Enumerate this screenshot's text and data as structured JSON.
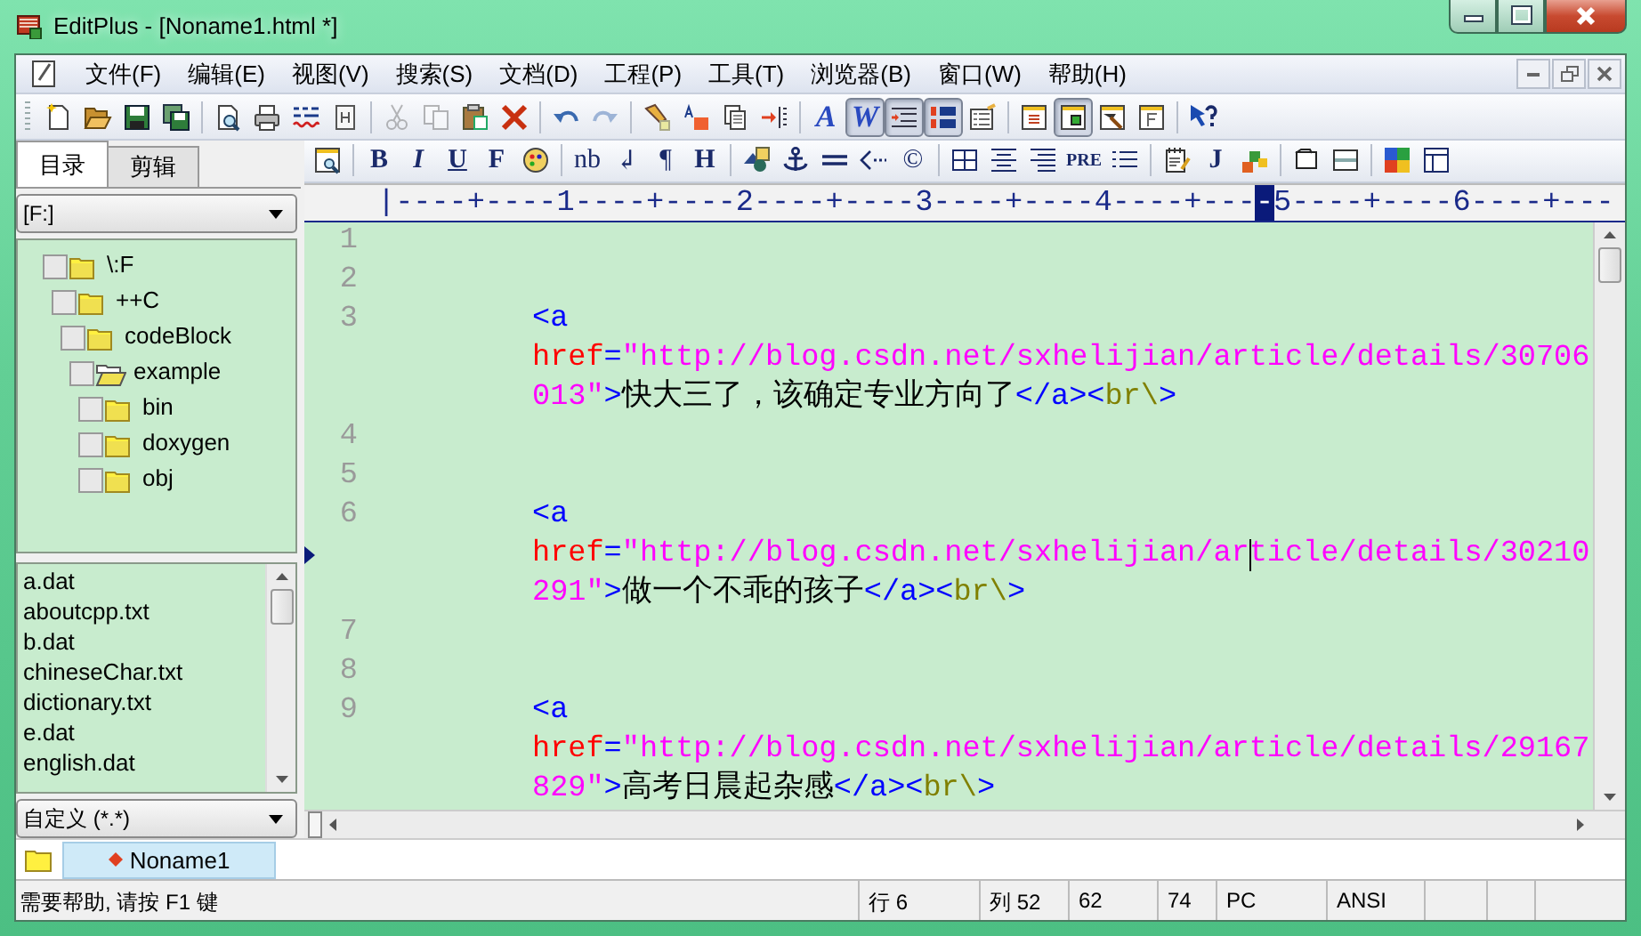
{
  "window": {
    "title": "EditPlus - [Noname1.html *]"
  },
  "menu": [
    "文件(F)",
    "编辑(E)",
    "视图(V)",
    "搜索(S)",
    "文档(D)",
    "工程(P)",
    "工具(T)",
    "浏览器(B)",
    "窗口(W)",
    "帮助(H)"
  ],
  "toolbar_main": [
    {
      "kind": "icon",
      "pressed": false,
      "disabled": false
    },
    {
      "kind": "icon",
      "pressed": false,
      "disabled": false
    },
    {
      "kind": "icon",
      "pressed": false,
      "disabled": false
    },
    {
      "kind": "icon",
      "pressed": false,
      "disabled": false
    },
    {
      "kind": "sep"
    },
    {
      "kind": "icon",
      "pressed": false,
      "disabled": false
    },
    {
      "kind": "icon",
      "pressed": false,
      "disabled": false
    },
    {
      "kind": "icon",
      "pressed": false,
      "disabled": false
    },
    {
      "kind": "icon",
      "pressed": false,
      "disabled": false
    },
    {
      "kind": "sep"
    },
    {
      "kind": "icon",
      "pressed": false,
      "disabled": true
    },
    {
      "kind": "icon",
      "pressed": false,
      "disabled": true
    },
    {
      "kind": "icon",
      "pressed": false,
      "disabled": false
    },
    {
      "kind": "icon",
      "pressed": false,
      "disabled": false
    },
    {
      "kind": "sep"
    },
    {
      "kind": "icon",
      "pressed": false,
      "disabled": false
    },
    {
      "kind": "icon",
      "pressed": false,
      "disabled": true
    },
    {
      "kind": "sep"
    },
    {
      "kind": "icon",
      "pressed": false,
      "disabled": false
    },
    {
      "kind": "icon",
      "pressed": false,
      "disabled": false
    },
    {
      "kind": "icon",
      "pressed": false,
      "disabled": false
    },
    {
      "kind": "icon",
      "pressed": false,
      "disabled": false
    },
    {
      "kind": "sep"
    },
    {
      "kind": "text",
      "label": "A",
      "pressed": false,
      "disabled": false
    },
    {
      "kind": "text",
      "label": "W",
      "pressed": true,
      "disabled": false
    },
    {
      "kind": "icon",
      "pressed": true,
      "disabled": false
    },
    {
      "kind": "icon",
      "pressed": true,
      "disabled": false
    },
    {
      "kind": "icon",
      "pressed": false,
      "disabled": false
    },
    {
      "kind": "sep"
    },
    {
      "kind": "icon",
      "pressed": false,
      "disabled": false
    },
    {
      "kind": "icon",
      "pressed": true,
      "disabled": false
    },
    {
      "kind": "icon",
      "pressed": false,
      "disabled": false
    },
    {
      "kind": "icon",
      "pressed": false,
      "disabled": false
    },
    {
      "kind": "sep"
    },
    {
      "kind": "icon",
      "pressed": false,
      "disabled": false
    }
  ],
  "toolbar_html": [
    {
      "kind": "icon",
      "pressed": false,
      "disabled": false
    },
    {
      "kind": "sep"
    },
    {
      "kind": "text",
      "label": "B",
      "pressed": false,
      "disabled": false
    },
    {
      "kind": "text",
      "label": "I",
      "pressed": false,
      "disabled": false
    },
    {
      "kind": "text",
      "label": "U",
      "pressed": false,
      "disabled": false
    },
    {
      "kind": "text",
      "label": "F",
      "pressed": false,
      "disabled": false
    },
    {
      "kind": "icon",
      "pressed": false,
      "disabled": false
    },
    {
      "kind": "sep"
    },
    {
      "kind": "text",
      "label": "nb",
      "pressed": false,
      "disabled": false
    },
    {
      "kind": "text",
      "label": "↲",
      "pressed": false,
      "disabled": false
    },
    {
      "kind": "text",
      "label": "¶",
      "pressed": false,
      "disabled": false
    },
    {
      "kind": "text",
      "label": "H",
      "pressed": false,
      "disabled": false
    },
    {
      "kind": "sep"
    },
    {
      "kind": "icon",
      "pressed": false,
      "disabled": false
    },
    {
      "kind": "icon",
      "pressed": false,
      "disabled": false
    },
    {
      "kind": "icon",
      "pressed": false,
      "disabled": false
    },
    {
      "kind": "icon",
      "pressed": false,
      "disabled": false
    },
    {
      "kind": "text",
      "label": "©",
      "pressed": false,
      "disabled": false
    },
    {
      "kind": "sep"
    },
    {
      "kind": "icon",
      "pressed": false,
      "disabled": false
    },
    {
      "kind": "icon",
      "pressed": false,
      "disabled": false
    },
    {
      "kind": "icon",
      "pressed": false,
      "disabled": false
    },
    {
      "kind": "text",
      "label": "PRE",
      "pressed": false,
      "disabled": false
    },
    {
      "kind": "icon",
      "pressed": false,
      "disabled": false
    },
    {
      "kind": "sep"
    },
    {
      "kind": "icon",
      "pressed": false,
      "disabled": false
    },
    {
      "kind": "text",
      "label": "J",
      "pressed": false,
      "disabled": false
    },
    {
      "kind": "icon",
      "pressed": false,
      "disabled": false
    },
    {
      "kind": "sep"
    },
    {
      "kind": "icon",
      "pressed": false,
      "disabled": false
    },
    {
      "kind": "icon",
      "pressed": false,
      "disabled": false
    },
    {
      "kind": "sep"
    },
    {
      "kind": "icon",
      "pressed": false,
      "disabled": false
    },
    {
      "kind": "icon",
      "pressed": false,
      "disabled": false
    }
  ],
  "sidebar": {
    "tabs": [
      {
        "label": "目录",
        "selected": true
      },
      {
        "label": "剪辑",
        "selected": false
      }
    ],
    "drive": "[F:]",
    "tree": [
      {
        "label": "\\:F",
        "open": false,
        "children": [
          {
            "label": "++C",
            "open": false,
            "children": [
              {
                "label": "codeBlock",
                "open": false,
                "children": [
                  {
                    "label": "example",
                    "open": true,
                    "children": [
                      {
                        "label": "bin",
                        "open": false
                      },
                      {
                        "label": "doxygen",
                        "open": false
                      },
                      {
                        "label": "obj",
                        "open": false
                      }
                    ]
                  }
                ]
              }
            ]
          }
        ]
      }
    ],
    "files": [
      "a.dat",
      "aboutcpp.txt",
      "b.dat",
      "chineseChar.txt",
      "dictionary.txt",
      "e.dat",
      "english.dat"
    ],
    "filter": "自定义 (*.*)"
  },
  "editor": {
    "ruler": {
      "before": "|----+----1----+----2----+----3----+----4----+---",
      "marker": "-",
      "after": "5----+----6----+---"
    },
    "lines": [
      {
        "number": "1"
      },
      {
        "number": "2"
      },
      {
        "number": "3",
        "rows": [
          {
            "current": false,
            "tokens": [
              {
                "kind": "tag",
                "text": "<a"
              }
            ]
          },
          {
            "current": false,
            "tokens": [
              {
                "kind": "attr",
                "text": "href"
              },
              {
                "kind": "tag",
                "text": "="
              },
              {
                "kind": "value",
                "text": "\"http://blog.csdn.net/sxhelijian/article/details/30706"
              }
            ]
          },
          {
            "current": false,
            "tokens": [
              {
                "kind": "value",
                "text": "013\""
              },
              {
                "kind": "tag",
                "text": ">"
              },
              {
                "kind": "text",
                "text": "快大三了，该确定专业方向了"
              },
              {
                "kind": "tag",
                "text": "</a><"
              },
              {
                "kind": "br",
                "text": "br\\"
              },
              {
                "kind": "tag",
                "text": ">"
              }
            ]
          }
        ]
      },
      {
        "number": "4"
      },
      {
        "number": "5"
      },
      {
        "number": "6",
        "rows": [
          {
            "current": false,
            "tokens": [
              {
                "kind": "tag",
                "text": "<a"
              }
            ]
          },
          {
            "current": true,
            "tokens": [
              {
                "kind": "attr",
                "text": "href"
              },
              {
                "kind": "tag",
                "text": "="
              },
              {
                "kind": "value",
                "text": "\"http://blog.csdn.net/sxhelijian/ar"
              },
              {
                "kind": "caret"
              },
              {
                "kind": "value",
                "text": "ticle/details/30210"
              }
            ]
          },
          {
            "current": false,
            "tokens": [
              {
                "kind": "value",
                "text": "291\""
              },
              {
                "kind": "tag",
                "text": ">"
              },
              {
                "kind": "text",
                "text": "做一个不乖的孩子"
              },
              {
                "kind": "tag",
                "text": "</a><"
              },
              {
                "kind": "br",
                "text": "br\\"
              },
              {
                "kind": "tag",
                "text": ">"
              }
            ]
          }
        ]
      },
      {
        "number": "7"
      },
      {
        "number": "8"
      },
      {
        "number": "9",
        "rows": [
          {
            "current": false,
            "tokens": [
              {
                "kind": "tag",
                "text": "<a"
              }
            ]
          },
          {
            "current": false,
            "tokens": [
              {
                "kind": "attr",
                "text": "href"
              },
              {
                "kind": "tag",
                "text": "="
              },
              {
                "kind": "value",
                "text": "\"http://blog.csdn.net/sxhelijian/article/details/29167"
              }
            ]
          },
          {
            "current": false,
            "tokens": [
              {
                "kind": "value",
                "text": "829\""
              },
              {
                "kind": "tag",
                "text": ">"
              },
              {
                "kind": "text",
                "text": "高考日晨起杂感"
              },
              {
                "kind": "tag",
                "text": "</a><"
              },
              {
                "kind": "br",
                "text": "br\\"
              },
              {
                "kind": "tag",
                "text": ">"
              }
            ]
          }
        ]
      }
    ]
  },
  "document_tabs": [
    {
      "label": "Noname1",
      "selected": true,
      "modified": true
    }
  ],
  "status_bar": {
    "message": "需要帮助, 请按 F1 键",
    "cells": [
      "行 6",
      "列 52",
      "62",
      "74",
      "PC",
      "ANSI"
    ]
  }
}
